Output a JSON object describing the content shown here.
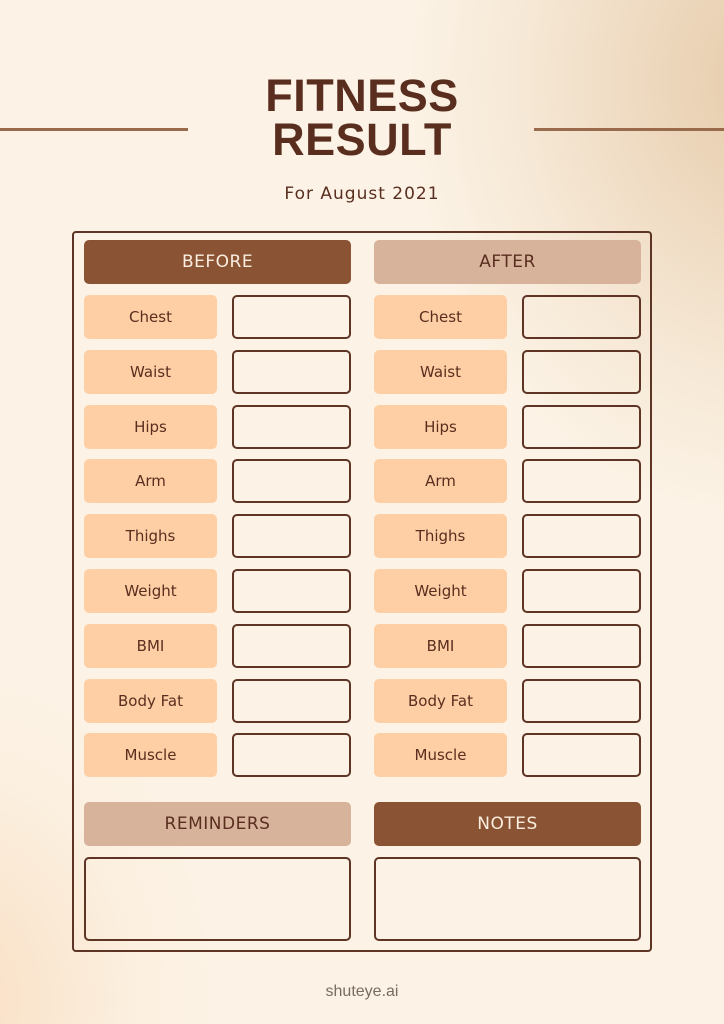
{
  "title": {
    "line1": "FITNESS",
    "line2": "RESULT",
    "subtitle": "For August 2021"
  },
  "colors": {
    "title_text": "#5a2e1f",
    "dark_header": "#8a5434",
    "light_header": "#d8b39c",
    "label_fill": "#fecfa5",
    "border": "#5e3424",
    "background": "#fcf3e6"
  },
  "before": {
    "header": "BEFORE",
    "rows": [
      {
        "label": "Chest",
        "value": ""
      },
      {
        "label": "Waist",
        "value": ""
      },
      {
        "label": "Hips",
        "value": ""
      },
      {
        "label": "Arm",
        "value": ""
      },
      {
        "label": "Thighs",
        "value": ""
      },
      {
        "label": "Weight",
        "value": ""
      },
      {
        "label": "BMI",
        "value": ""
      },
      {
        "label": "Body Fat",
        "value": ""
      },
      {
        "label": "Muscle",
        "value": ""
      }
    ]
  },
  "after": {
    "header": "AFTER",
    "rows": [
      {
        "label": "Chest",
        "value": ""
      },
      {
        "label": "Waist",
        "value": ""
      },
      {
        "label": "Hips",
        "value": ""
      },
      {
        "label": "Arm",
        "value": ""
      },
      {
        "label": "Thighs",
        "value": ""
      },
      {
        "label": "Weight",
        "value": ""
      },
      {
        "label": "BMI",
        "value": ""
      },
      {
        "label": "Body Fat",
        "value": ""
      },
      {
        "label": "Muscle",
        "value": ""
      }
    ]
  },
  "reminders": {
    "header": "REMINDERS",
    "value": ""
  },
  "notes": {
    "header": "NOTES",
    "value": ""
  },
  "footer": {
    "brand": "shuteye.ai"
  }
}
